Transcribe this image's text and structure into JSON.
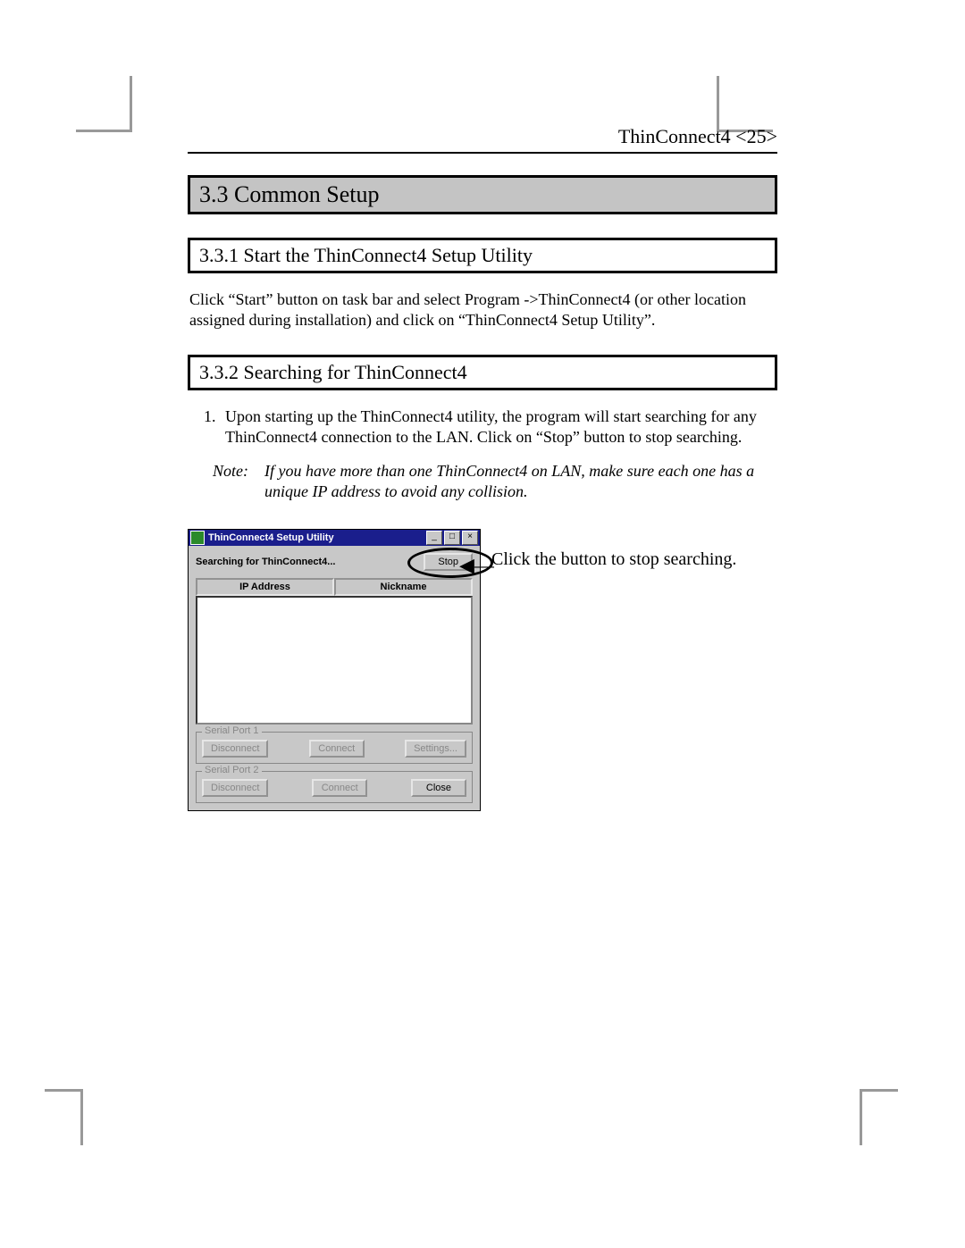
{
  "header": {
    "text": "ThinConnect4 <25>"
  },
  "section": {
    "title": "3.3 Common Setup",
    "sub1": {
      "title": "3.3.1 Start the ThinConnect4 Setup Utility",
      "para": "Click “Start” button on task bar and select Program ->ThinConnect4 (or other location assigned during installation) and click on “ThinConnect4 Setup Utility”."
    },
    "sub2": {
      "title": "3.3.2 Searching for ThinConnect4",
      "item1": "Upon starting up the ThinConnect4 utility, the program will start searching for any ThinConnect4 connection to the LAN.  Click on “Stop” button to stop searching.",
      "note_label": "Note:",
      "note_text": "If you have more than one ThinConnect4 on LAN, make sure each one has a unique IP address to avoid any collision."
    }
  },
  "callout": {
    "text": "Click the button to stop searching."
  },
  "app": {
    "title": "ThinConnect4 Setup Utility",
    "status": "Searching for ThinConnect4...",
    "stop_label": "Stop",
    "cols": {
      "ip": "IP Address",
      "nick": "Nickname"
    },
    "port1": {
      "legend": "Serial Port 1",
      "disconnect": "Disconnect",
      "connect": "Connect",
      "settings": "Settings..."
    },
    "port2": {
      "legend": "Serial Port 2",
      "disconnect": "Disconnect",
      "connect": "Connect",
      "close": "Close"
    },
    "winbtn": {
      "min": "_",
      "max": "□",
      "close": "×"
    }
  }
}
